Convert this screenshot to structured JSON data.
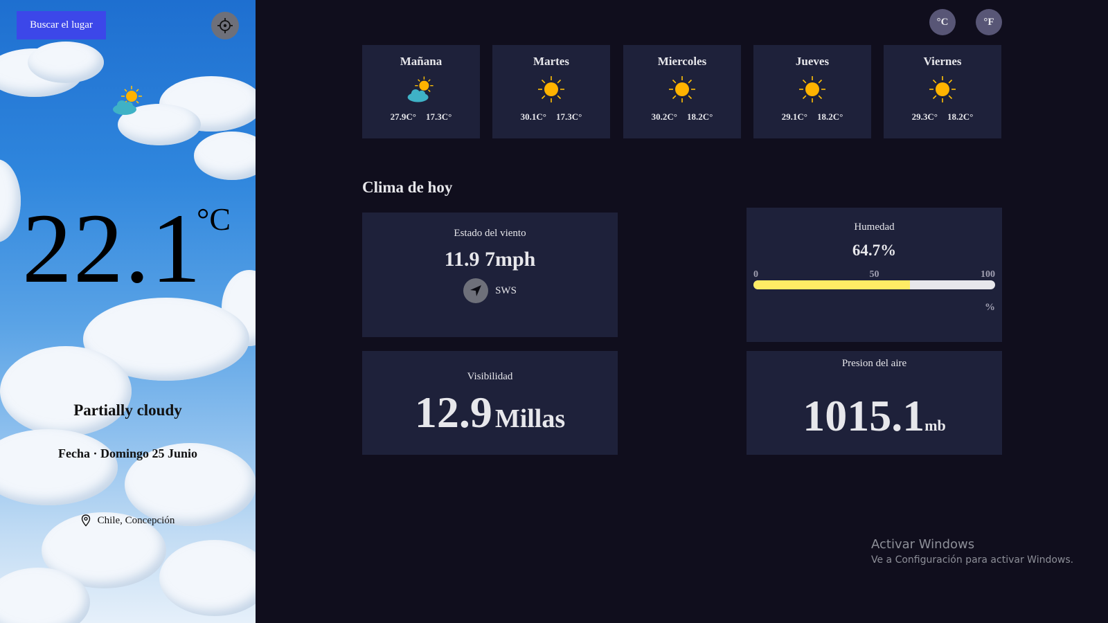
{
  "sidebar": {
    "search_label": "Buscar el lugar",
    "locate_icon": "crosshair-icon",
    "current_icon": "partly-cloudy-icon",
    "temperature": "22.1",
    "temperature_unit": "°C",
    "condition": "Partially cloudy",
    "date": "Fecha · Domingo 25 Junio",
    "location": "Chile, Concepción",
    "location_icon": "map-pin-icon"
  },
  "units": {
    "celsius": "°C",
    "fahrenheit": "°F"
  },
  "forecast": [
    {
      "day": "Mañana",
      "icon": "partly-cloudy-icon",
      "max": "27.9C°",
      "min": "17.3C°"
    },
    {
      "day": "Martes",
      "icon": "sun-icon",
      "max": "30.1C°",
      "min": "17.3C°"
    },
    {
      "day": "Miercoles",
      "icon": "sun-icon",
      "max": "30.2C°",
      "min": "18.2C°"
    },
    {
      "day": "Jueves",
      "icon": "sun-icon",
      "max": "29.1C°",
      "min": "18.2C°"
    },
    {
      "day": "Viernes",
      "icon": "sun-icon",
      "max": "29.3C°",
      "min": "18.2C°"
    }
  ],
  "today": {
    "title": "Clima de hoy",
    "wind": {
      "label": "Estado del viento",
      "value": "11.9 7mph",
      "direction": "SWS",
      "icon": "navigation-arrow-icon"
    },
    "humidity": {
      "label": "Humedad",
      "value": "64.7%",
      "fill_percent": 64.7,
      "scale": [
        "0",
        "50",
        "100"
      ],
      "unit": "%"
    },
    "visibility": {
      "label": "Visibilidad",
      "value": "12.9",
      "unit": "Millas"
    },
    "pressure": {
      "label": "Presion del aire",
      "value": "1015.1",
      "unit": "mb"
    }
  },
  "watermark": {
    "title": "Activar Windows",
    "subtitle": "Ve a Configuración para activar Windows."
  },
  "colors": {
    "background": "#100e1d",
    "card": "#1e213a",
    "search_button": "#3c47e9",
    "humidity_fill": "#ffec65",
    "unit_button": "#585676",
    "sun": "#ffc107"
  }
}
